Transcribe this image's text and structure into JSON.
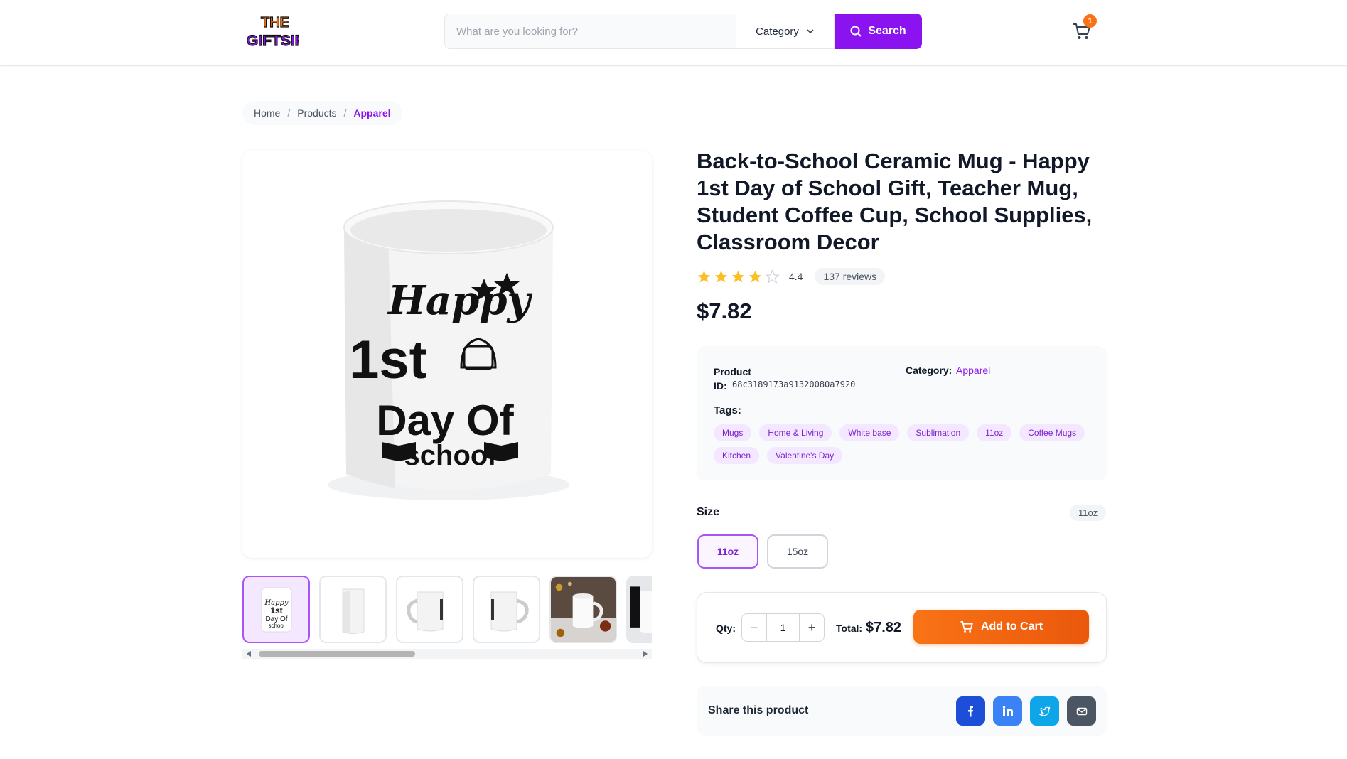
{
  "header": {
    "logo_text": [
      "THE",
      "GIFTSIP"
    ],
    "search": {
      "placeholder": "What are you looking for?",
      "button_label": "Search"
    },
    "category_label": "Category",
    "cart_count": "1"
  },
  "breadcrumb": [
    {
      "label": "Home"
    },
    {
      "label": "Products"
    },
    {
      "label": "Apparel"
    }
  ],
  "product": {
    "title": "Back-to-School Ceramic Mug - Happy 1st Day of School Gift, Teacher Mug, Student Coffee Cup, School Supplies, Classroom Decor",
    "rating": "4.4",
    "rating_value": 4.4,
    "rating_max": 5,
    "reviews": "137 reviews",
    "price": "$7.82",
    "image_text": {
      "line1": "Happy",
      "line2": "1st",
      "line3": "Day Of",
      "line4": "school"
    },
    "id_label": "Product ID:",
    "id_value": "68c3189173a91320080a7920",
    "category_label": "Category:",
    "category_value": "Apparel",
    "tags_label": "Tags:",
    "tags": [
      "Mugs",
      "Home & Living",
      "White base",
      "Sublimation",
      "11oz",
      "Coffee Mugs",
      "Kitchen",
      "Valentine's Day"
    ],
    "size_label": "Size",
    "size_selected": "11oz",
    "sizes": [
      "11oz",
      "15oz"
    ]
  },
  "purchase": {
    "qty_label": "Qty:",
    "qty_value": "1",
    "minus": "−",
    "plus": "+",
    "total_label": "Total:",
    "total_value": "$7.82",
    "add_label": "Add to Cart"
  },
  "share": {
    "label": "Share this product"
  },
  "colors": {
    "accent": "#8b13f0",
    "orange": "#f97316",
    "facebook": "#1d4ed8",
    "linkedin": "#3b82f6",
    "twitter": "#0ea5e9",
    "email": "#4b5563"
  }
}
